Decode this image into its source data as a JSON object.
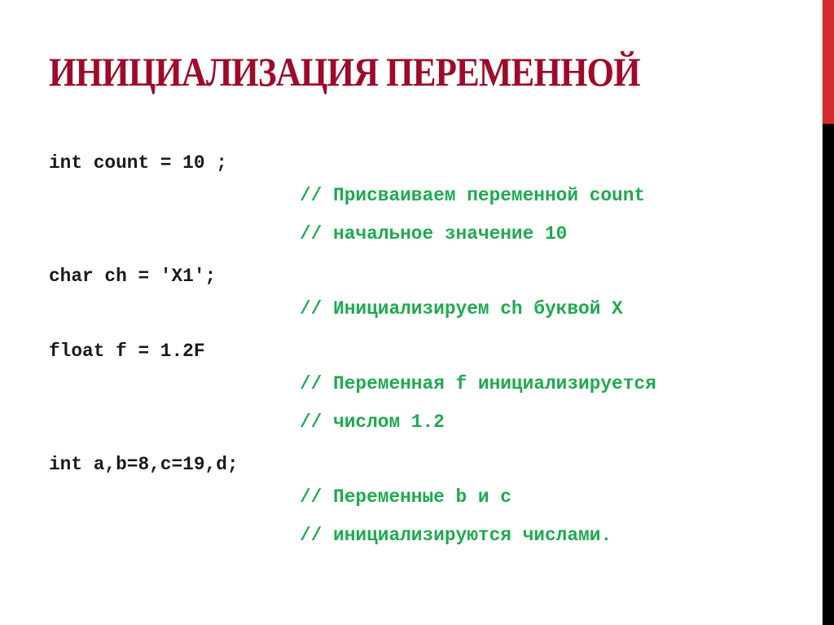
{
  "slide": {
    "title": "ИНИЦИАЛИЗАЦИЯ ПЕРЕМЕННОЙ",
    "colors": {
      "title": "#9e0a2a",
      "code": "#1a1a1a",
      "comment": "#1eaa4f",
      "accent_red": "#d42b2e",
      "accent_black": "#000000"
    }
  },
  "code_lines": [
    {
      "code": "int count = 10 ;",
      "comment": "// Присваиваем переменной count"
    },
    {
      "code": "",
      "comment": "// начальное значение 10"
    },
    {
      "code": "char ch = 'X1';",
      "comment": "// Инициализируем ch буквой X"
    },
    {
      "code": "float f = 1.2F",
      "comment": "// Переменная f инициализируется"
    },
    {
      "code": "",
      "comment": "// числом 1.2"
    },
    {
      "code": "int a,b=8,c=19,d;",
      "comment": "// Переменные b и c"
    },
    {
      "code": "",
      "comment": "// инициализируются числами."
    }
  ]
}
